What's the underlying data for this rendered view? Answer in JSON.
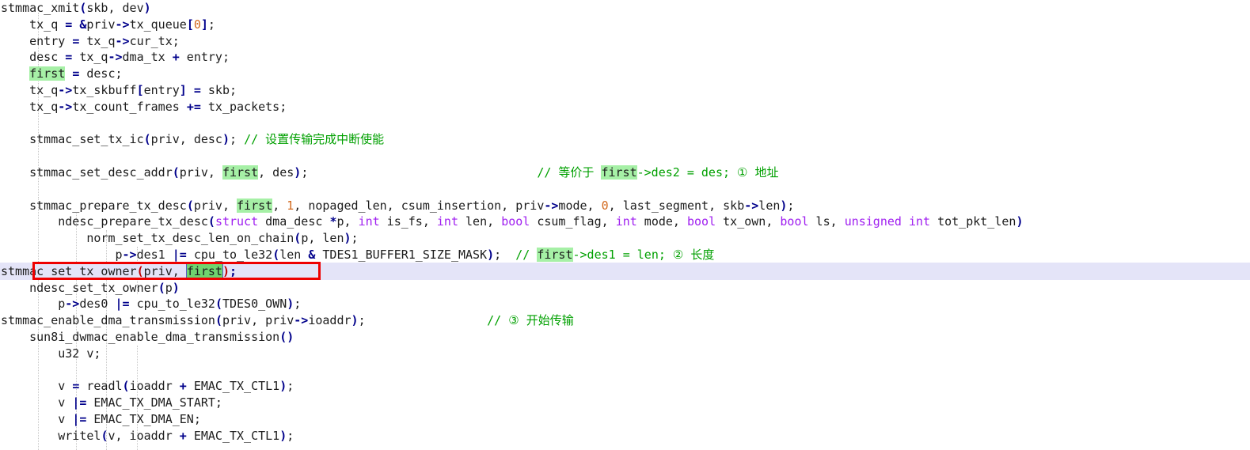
{
  "editor": {
    "title": "stmmac_xmit call trace",
    "language": "c",
    "colors": {
      "background": "#ffffff",
      "text": "#1c1c1c",
      "operator": "#00008b",
      "keyword": "#a020f0",
      "number": "#d2691e",
      "comment": "#00a000",
      "search_highlight": "#a6f0a6",
      "selection_row": "#e4e4f8",
      "annotation_box": "#ee0000",
      "indent_guide": "#c8c8c8"
    },
    "search_term": "first",
    "selected_line_number": 17
  },
  "lines": [
    {
      "n": 1,
      "indent": 0,
      "text": "stmmac_xmit(skb, dev)"
    },
    {
      "n": 2,
      "indent": 1,
      "text": "tx_q = &priv->tx_queue[0];"
    },
    {
      "n": 3,
      "indent": 1,
      "text": "entry = tx_q->cur_tx;"
    },
    {
      "n": 4,
      "indent": 1,
      "text": "desc = tx_q->dma_tx + entry;"
    },
    {
      "n": 5,
      "indent": 1,
      "text": "first = desc;"
    },
    {
      "n": 6,
      "indent": 1,
      "text": "tx_q->tx_skbuff[entry] = skb;"
    },
    {
      "n": 7,
      "indent": 1,
      "text": "tx_q->tx_count_frames += tx_packets;"
    },
    {
      "n": 8,
      "indent": 1,
      "text": ""
    },
    {
      "n": 9,
      "indent": 1,
      "text": "stmmac_set_tx_ic(priv, desc); // 设置传输完成中断使能"
    },
    {
      "n": 10,
      "indent": 1,
      "text": ""
    },
    {
      "n": 11,
      "indent": 1,
      "text": "stmmac_set_desc_addr(priv, first, des);",
      "comment": "// 等价于 first->des2 = des; ① 地址"
    },
    {
      "n": 12,
      "indent": 1,
      "text": ""
    },
    {
      "n": 13,
      "indent": 1,
      "text": "stmmac_prepare_tx_desc(priv, first, 1, nopaged_len, csum_insertion, priv->mode, 0, last_segment, skb->len);"
    },
    {
      "n": 14,
      "indent": 2,
      "text": "ndesc_prepare_tx_desc(struct dma_desc *p, int is_fs, int len, bool csum_flag, int mode, bool tx_own, bool ls, unsigned int tot_pkt_len)"
    },
    {
      "n": 15,
      "indent": 3,
      "text": "norm_set_tx_desc_len_on_chain(p, len);"
    },
    {
      "n": 16,
      "indent": 4,
      "text": "p->des1 |= cpu_to_le32(len & TDES1_BUFFER1_SIZE_MASK);  // first->des1 = len; ② 长度"
    },
    {
      "n": 17,
      "indent": 0,
      "text": "stmmac_set_tx_owner(priv, first);",
      "selected": true
    },
    {
      "n": 18,
      "indent": 1,
      "text": "ndesc_set_tx_owner(p)"
    },
    {
      "n": 19,
      "indent": 2,
      "text": "p->des0 |= cpu_to_le32(TDES0_OWN);"
    },
    {
      "n": 20,
      "indent": 0,
      "text": "stmmac_enable_dma_transmission(priv, priv->ioaddr);",
      "comment": "// ③ 开始传输"
    },
    {
      "n": 21,
      "indent": 1,
      "text": "sun8i_dwmac_enable_dma_transmission()"
    },
    {
      "n": 22,
      "indent": 2,
      "text": "u32 v;"
    },
    {
      "n": 23,
      "indent": 2,
      "text": ""
    },
    {
      "n": 24,
      "indent": 2,
      "text": "v = readl(ioaddr + EMAC_TX_CTL1);"
    },
    {
      "n": 25,
      "indent": 2,
      "text": "v |= EMAC_TX_DMA_START;"
    },
    {
      "n": 26,
      "indent": 2,
      "text": "v |= EMAC_TX_DMA_EN;"
    },
    {
      "n": 27,
      "indent": 2,
      "text": "writel(v, ioaddr + EMAC_TX_CTL1);"
    }
  ],
  "annotations": {
    "step1_label": "① 地址",
    "step2_label": "② 长度",
    "step3_label": "③ 开始传输",
    "comment_set_tx_ic": "// 设置传输完成中断使能",
    "comment_set_desc_addr": "// 等价于 first->des2 = des; ① 地址",
    "comment_des1": "// first->des1 = len; ② 长度",
    "comment_enable_dma": "// ③ 开始传输"
  },
  "indent_guides_x": [
    48,
    96,
    134,
    173,
    211
  ]
}
